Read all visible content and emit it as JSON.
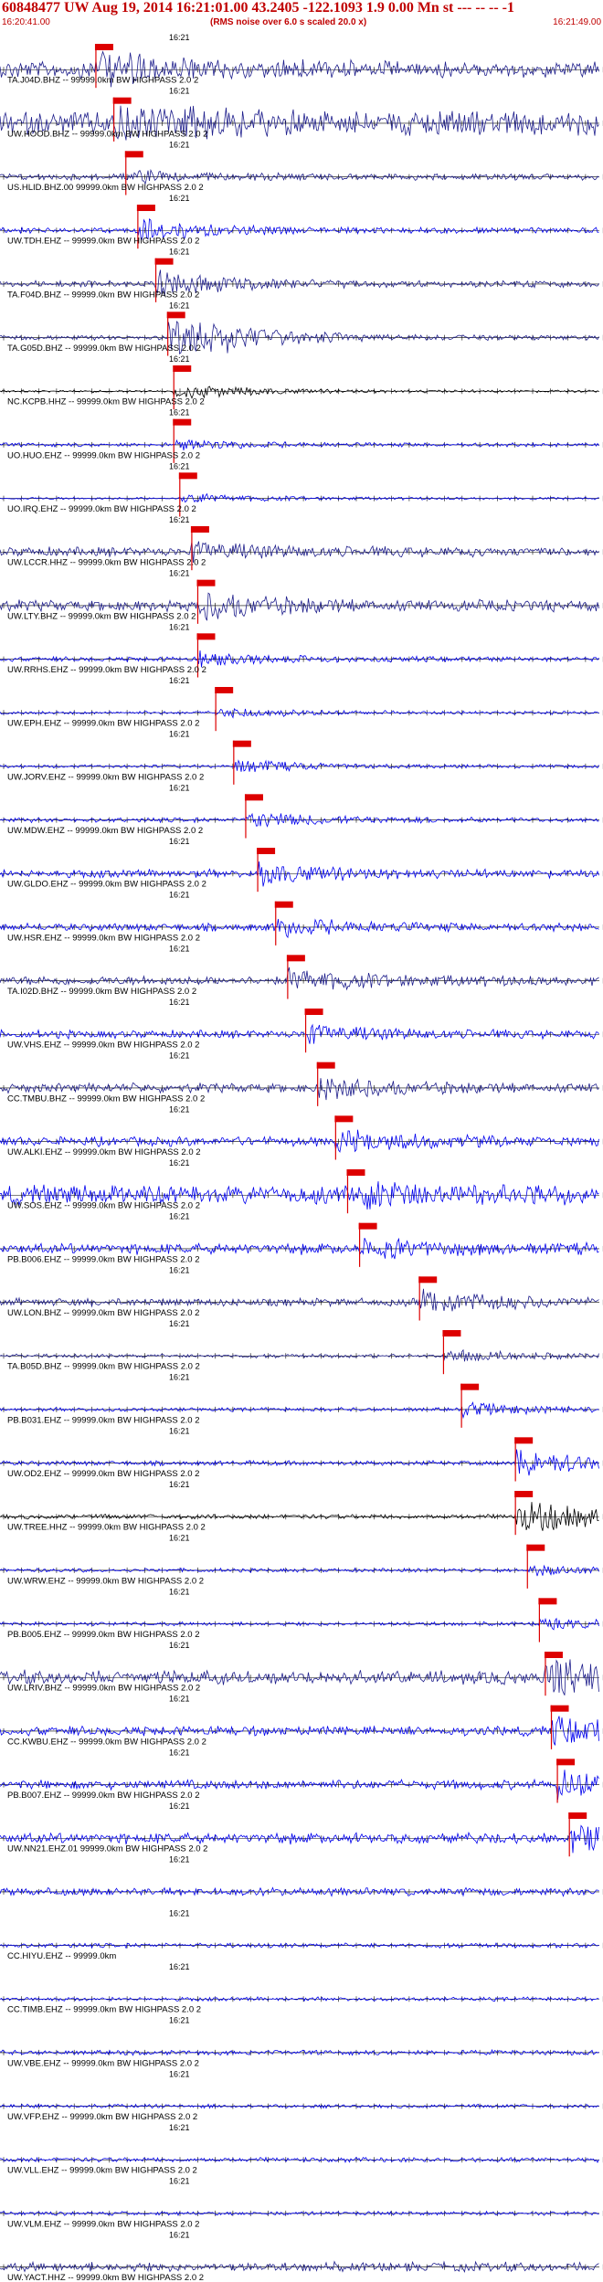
{
  "header": {
    "title": "60848477 UW Aug 19, 2014 16:21:01.00   43.2405 -122.1093  1.9 0.00 Mn st --- -- -- -1",
    "start_time": "16:20:41.00",
    "end_time": "16:21:49.00",
    "rms_note": "(RMS noise over 6.0 s scaled 20.0 x)"
  },
  "colors": {
    "primary_trace": "#1f1f8c",
    "trace": "#0000ee",
    "black_trace": "#000000",
    "pick": "#dd0000",
    "label": "#000000",
    "axis": "#000000"
  },
  "minute_label": "16:21",
  "channels": [
    {
      "label": "TA.J04D.BHZ -- 99999.0km BW  HIGHPASS  2.0  2",
      "color": "primary",
      "amp": 0.55,
      "pick": 0.16,
      "burst": 0.8
    },
    {
      "label": "UW.HOOD.BHZ -- 99999.0km BW  HIGHPASS  2.0  2",
      "color": "primary",
      "amp": 0.75,
      "pick": 0.19,
      "burst": 0.9
    },
    {
      "label": "US.HLID.BHZ.00 99999.0km BW  HIGHPASS  2.0  2",
      "color": "primary",
      "amp": 0.2,
      "pick": 0.21,
      "burst": 0.3
    },
    {
      "label": "UW.TDH.EHZ -- 99999.0km BW  HIGHPASS  2.0  2",
      "color": "trace",
      "amp": 0.18,
      "pick": 0.23,
      "burst": 0.6
    },
    {
      "label": "TA.F04D.BHZ -- 99999.0km BW  HIGHPASS  2.0  2",
      "color": "primary",
      "amp": 0.2,
      "pick": 0.26,
      "burst": 0.7
    },
    {
      "label": "TA.G05D.BHZ -- 99999.0km BW  HIGHPASS  2.0  2",
      "color": "primary",
      "amp": 0.15,
      "pick": 0.28,
      "burst": 1.8
    },
    {
      "label": "NC.KCPB.HHZ -- 99999.0km BW  HIGHPASS  2.0  2",
      "color": "black",
      "amp": 0.08,
      "pick": 0.29,
      "burst": 0.5
    },
    {
      "label": "UO.HUO.EHZ -- 99999.0km BW  HIGHPASS  2.0  2",
      "color": "trace",
      "amp": 0.12,
      "pick": 0.29,
      "burst": 0.3
    },
    {
      "label": "UO.IRQ.EHZ -- 99999.0km BW  HIGHPASS  2.0  2",
      "color": "trace",
      "amp": 0.08,
      "pick": 0.3,
      "burst": 0.3
    },
    {
      "label": "UW.LCCR.HHZ -- 99999.0km BW  HIGHPASS  2.0  2",
      "color": "primary",
      "amp": 0.3,
      "pick": 0.32,
      "burst": 0.5
    },
    {
      "label": "UW.LTY.BHZ -- 99999.0km BW  HIGHPASS  2.0  2",
      "color": "primary",
      "amp": 0.35,
      "pick": 0.33,
      "burst": 0.8
    },
    {
      "label": "UW.RRHS.EHZ -- 99999.0km BW  HIGHPASS  2.0  2",
      "color": "trace",
      "amp": 0.15,
      "pick": 0.33,
      "burst": 0.4
    },
    {
      "label": "UW.EPH.EHZ -- 99999.0km BW  HIGHPASS  2.0  2",
      "color": "trace",
      "amp": 0.1,
      "pick": 0.36,
      "burst": 0.3
    },
    {
      "label": "UW.JORV.EHZ -- 99999.0km BW  HIGHPASS  2.0  2",
      "color": "trace",
      "amp": 0.1,
      "pick": 0.39,
      "burst": 0.4
    },
    {
      "label": "UW.MDW.EHZ -- 99999.0km BW  HIGHPASS  2.0  2",
      "color": "trace",
      "amp": 0.15,
      "pick": 0.41,
      "burst": 0.5
    },
    {
      "label": "UW.GLDO.EHZ -- 99999.0km BW  HIGHPASS  2.0  2",
      "color": "trace",
      "amp": 0.25,
      "pick": 0.43,
      "burst": 0.6
    },
    {
      "label": "UW.HSR.EHZ -- 99999.0km BW  HIGHPASS  2.0  2",
      "color": "trace",
      "amp": 0.25,
      "pick": 0.46,
      "burst": 0.5
    },
    {
      "label": "TA.I02D.BHZ -- 99999.0km BW  HIGHPASS  2.0  2",
      "color": "primary",
      "amp": 0.3,
      "pick": 0.48,
      "burst": 0.6
    },
    {
      "label": "UW.VHS.EHZ -- 99999.0km BW  HIGHPASS  2.0  2",
      "color": "trace",
      "amp": 0.25,
      "pick": 0.51,
      "burst": 0.5
    },
    {
      "label": "CC.TMBU.BHZ -- 99999.0km BW  HIGHPASS  2.0  2",
      "color": "primary",
      "amp": 0.3,
      "pick": 0.53,
      "burst": 0.6
    },
    {
      "label": "UW.ALKI.EHZ -- 99999.0km BW  HIGHPASS  2.0  2",
      "color": "trace",
      "amp": 0.3,
      "pick": 0.56,
      "burst": 0.6
    },
    {
      "label": "UW.SOS.EHZ -- 99999.0km BW  HIGHPASS  2.0  2",
      "color": "trace",
      "amp": 0.6,
      "pick": 0.58,
      "burst": 0.7
    },
    {
      "label": "PB.B006.EHZ -- 99999.0km BW  HIGHPASS  2.0  2",
      "color": "trace",
      "amp": 0.35,
      "pick": 0.6,
      "burst": 0.5
    },
    {
      "label": "UW.LON.BHZ -- 99999.0km BW  HIGHPASS  2.0  2",
      "color": "primary",
      "amp": 0.25,
      "pick": 0.7,
      "burst": 0.8
    },
    {
      "label": "TA.B05D.BHZ -- 99999.0km BW  HIGHPASS  2.0  2",
      "color": "primary",
      "amp": 0.12,
      "pick": 0.74,
      "burst": 0.4
    },
    {
      "label": "PB.B031.EHZ -- 99999.0km BW  HIGHPASS  2.0  2",
      "color": "trace",
      "amp": 0.12,
      "pick": 0.77,
      "burst": 0.4
    },
    {
      "label": "UW.OD2.EHZ -- 99999.0km BW  HIGHPASS  2.0  2",
      "color": "trace",
      "amp": 0.15,
      "pick": 0.86,
      "burst": 0.9
    },
    {
      "label": "UW.TREE.HHZ -- 99999.0km BW  HIGHPASS  2.0  2",
      "color": "black",
      "amp": 0.15,
      "pick": 0.86,
      "burst": 1.2
    },
    {
      "label": "UW.WRW.EHZ -- 99999.0km BW  HIGHPASS  2.0  2",
      "color": "trace",
      "amp": 0.12,
      "pick": 0.88,
      "burst": 0.3
    },
    {
      "label": "PB.B005.EHZ -- 99999.0km BW  HIGHPASS  2.0  2",
      "color": "trace",
      "amp": 0.12,
      "pick": 0.9,
      "burst": 0.3
    },
    {
      "label": "UW.LRIV.BHZ -- 99999.0km BW  HIGHPASS  2.0  2",
      "color": "primary",
      "amp": 0.45,
      "pick": 0.91,
      "burst": 1.6
    },
    {
      "label": "CC.KWBU.EHZ -- 99999.0km BW  HIGHPASS  2.0  2",
      "color": "trace",
      "amp": 0.3,
      "pick": 0.92,
      "burst": 0.8
    },
    {
      "label": "PB.B007.EHZ -- 99999.0km BW  HIGHPASS  2.0  2",
      "color": "trace",
      "amp": 0.3,
      "pick": 0.93,
      "burst": 0.8
    },
    {
      "label": "UW.NN21.EHZ.01 99999.0km BW  HIGHPASS  2.0  2",
      "color": "trace",
      "amp": 0.35,
      "pick": 0.95,
      "burst": 0.8
    },
    {
      "label": "",
      "color": "trace",
      "amp": 0.25,
      "pick": null,
      "burst": 0
    },
    {
      "label": "CC.HIYU.EHZ -- 99999.0km",
      "color": "trace",
      "amp": 0.15,
      "pick": null,
      "burst": 0
    },
    {
      "label": "CC.TIMB.EHZ -- 99999.0km BW  HIGHPASS  2.0  2",
      "color": "trace",
      "amp": 0.12,
      "pick": null,
      "burst": 0
    },
    {
      "label": "UW.VBE.EHZ -- 99999.0km BW  HIGHPASS  2.0  2",
      "color": "trace",
      "amp": 0.15,
      "pick": null,
      "burst": 0
    },
    {
      "label": "UW.VFP.EHZ -- 99999.0km BW  HIGHPASS  2.0  2",
      "color": "trace",
      "amp": 0.12,
      "pick": null,
      "burst": 0
    },
    {
      "label": "UW.VLL.EHZ -- 99999.0km BW  HIGHPASS  2.0  2",
      "color": "trace",
      "amp": 0.15,
      "pick": null,
      "burst": 0
    },
    {
      "label": "UW.VLM.EHZ -- 99999.0km BW  HIGHPASS  2.0  2",
      "color": "trace",
      "amp": 0.12,
      "pick": null,
      "burst": 0
    },
    {
      "label": "UW.YACT.HHZ -- 99999.0km BW  HIGHPASS  2.0  2",
      "color": "primary",
      "amp": 0.3,
      "pick": null,
      "burst": 0
    }
  ]
}
